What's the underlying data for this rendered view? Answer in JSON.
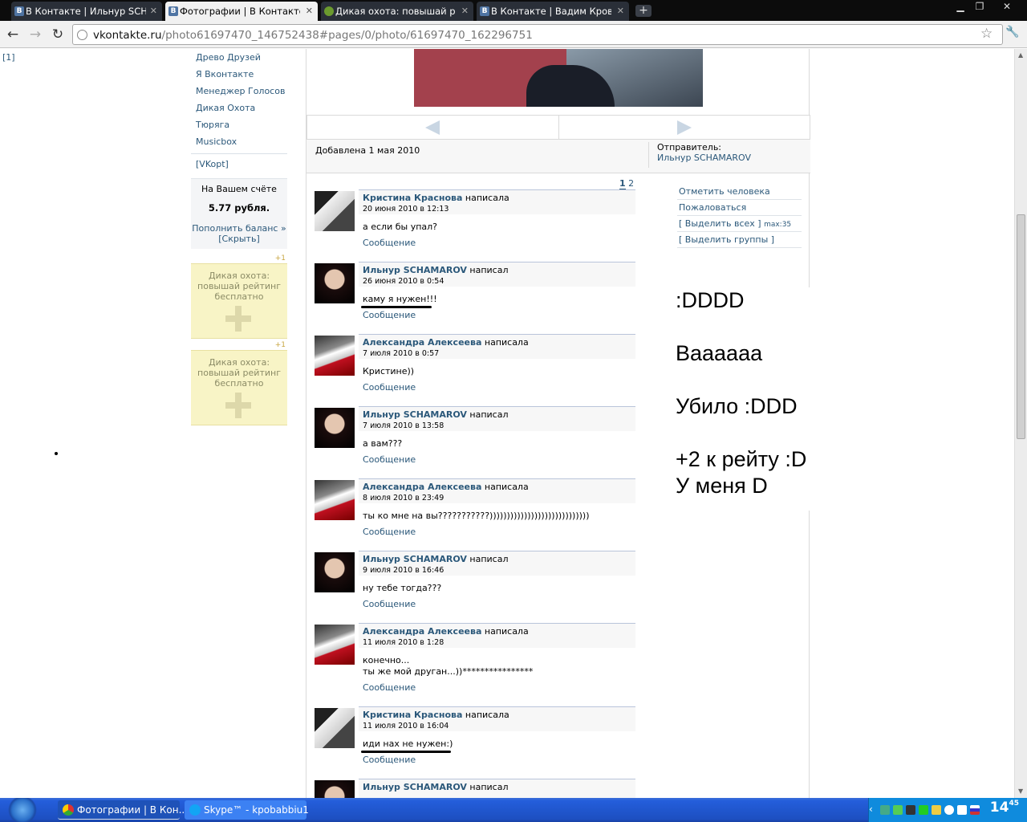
{
  "tabs": [
    {
      "label": "В Контакте | Ильнур SCH...",
      "icon": "vk-favicon"
    },
    {
      "label": "Фотографии | В Контакте...",
      "icon": "vk-favicon",
      "active": true
    },
    {
      "label": "Дикая охота: повышай р...",
      "icon": "game-favicon"
    },
    {
      "label": "В Контакте | Вадим Кров...",
      "icon": "vk-favicon"
    }
  ],
  "new_tab_symbol": "+",
  "url": {
    "domain": "vkontakte.ru",
    "path": "/photo61697470_146752438#pages/0/photo/61697470_162296751"
  },
  "left_counter": "[1]",
  "sidebar": {
    "links": [
      "Древо Друзей",
      "Я Вконтакте",
      "Менеджер Голосов",
      "Дикая Охота",
      "Тюряга",
      "Musicbox"
    ],
    "vkopt": "[VKopt]",
    "balance": {
      "title": "На Вашем счёте",
      "value": "5.77 рубля.",
      "topup": "Пополнить баланс »",
      "hide": "[Скрыть]"
    },
    "ads": [
      {
        "badge": "+1",
        "text": "Дикая охота: повышай рейтинг бесплатно"
      },
      {
        "badge": "+1",
        "text": "Дикая охота: повышай рейтинг бесплатно"
      }
    ]
  },
  "photo_info": {
    "added": "Добавлена 1 мая 2010",
    "sender_label": "Отправитель:",
    "sender_name": "Ильнур SCHAMAROV"
  },
  "pager": {
    "current": "1",
    "other": "2"
  },
  "actions": {
    "tag": "Отметить человека",
    "report": "Пожаловаться",
    "select_all": "[ Выделить всех ]",
    "select_all_max": "max:35",
    "select_groups": "[ Выделить группы ]"
  },
  "reply_label": "Сообщение",
  "comments": [
    {
      "name": "Кристина Краснова",
      "verb": "написала",
      "date": "20 июня 2010 в 12:13",
      "text": "а если бы упал?",
      "avatar": "kr"
    },
    {
      "name": "Ильнур SCHAMAROV",
      "verb": "написал",
      "date": "26 июня 2010 в 0:54",
      "text": "каму я нужен!!!",
      "avatar": "il",
      "underline": true
    },
    {
      "name": "Александра Алексеева",
      "verb": "написала",
      "date": "7 июля 2010 в 0:57",
      "text": "Кристине))",
      "avatar": "al"
    },
    {
      "name": "Ильнур SCHAMAROV",
      "verb": "написал",
      "date": "7 июля 2010 в 13:58",
      "text": "а вам???",
      "avatar": "il"
    },
    {
      "name": "Александра Алексеева",
      "verb": "написала",
      "date": "8 июля 2010 в 23:49",
      "text": "ты ко мне на вы???????????)))))))))))))))))))))))))))))",
      "avatar": "al"
    },
    {
      "name": "Ильнур SCHAMAROV",
      "verb": "написал",
      "date": "9 июля 2010 в 16:46",
      "text": "ну тебе тогда???",
      "avatar": "il"
    },
    {
      "name": "Александра Алексеева",
      "verb": "написала",
      "date": "11 июля 2010 в 1:28",
      "text": "конечно...\nты же мой друган...))****************",
      "avatar": "al",
      "tall": true
    },
    {
      "name": "Кристина Краснова",
      "verb": "написала",
      "date": "11 июля 2010 в 16:04",
      "text": "иди нах не нужен:)",
      "avatar": "kr",
      "underline": true
    },
    {
      "name": "Ильнур SCHAMAROV",
      "verb": "написал",
      "date": "",
      "text": "",
      "avatar": "il"
    }
  ],
  "overlay_lines": [
    ":DDDD",
    "",
    "Вааааaa",
    "",
    "Убило :DDD",
    "",
    "+2 к рейту :D",
    "У меня D"
  ],
  "taskbar": {
    "items": [
      {
        "label": "Фотографии | В Кон...",
        "icon": "chrome-icon"
      },
      {
        "label": "Skype™ - kpobabbiu1",
        "icon": "skype-icon"
      }
    ],
    "clock": "14",
    "clock_sub": "45"
  }
}
